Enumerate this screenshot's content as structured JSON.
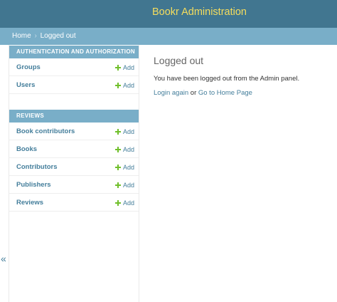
{
  "header": {
    "site_name": "Bookr Administration"
  },
  "breadcrumbs": {
    "home": "Home",
    "separator": "›",
    "current": "Logged out"
  },
  "sidebar": {
    "toggle_glyph": "«",
    "modules": [
      {
        "caption": "AUTHENTICATION AND AUTHORIZATION",
        "models": [
          {
            "name": "Groups",
            "add": "Add"
          },
          {
            "name": "Users",
            "add": "Add"
          }
        ]
      },
      {
        "caption": "REVIEWS",
        "models": [
          {
            "name": "Book contributors",
            "add": "Add"
          },
          {
            "name": "Books",
            "add": "Add"
          },
          {
            "name": "Contributors",
            "add": "Add"
          },
          {
            "name": "Publishers",
            "add": "Add"
          },
          {
            "name": "Reviews",
            "add": "Add"
          }
        ]
      }
    ]
  },
  "content": {
    "title": "Logged out",
    "message": "You have been logged out from the Admin panel.",
    "login_again": "Login again",
    "or_text": "or",
    "home_link": "Go to Home Page"
  },
  "colors": {
    "header_bg": "#417690",
    "branding": "#f5dd5d",
    "breadcrumb_bg": "#79aec8",
    "link": "#447e9b",
    "add_icon": "#70bf2b"
  }
}
